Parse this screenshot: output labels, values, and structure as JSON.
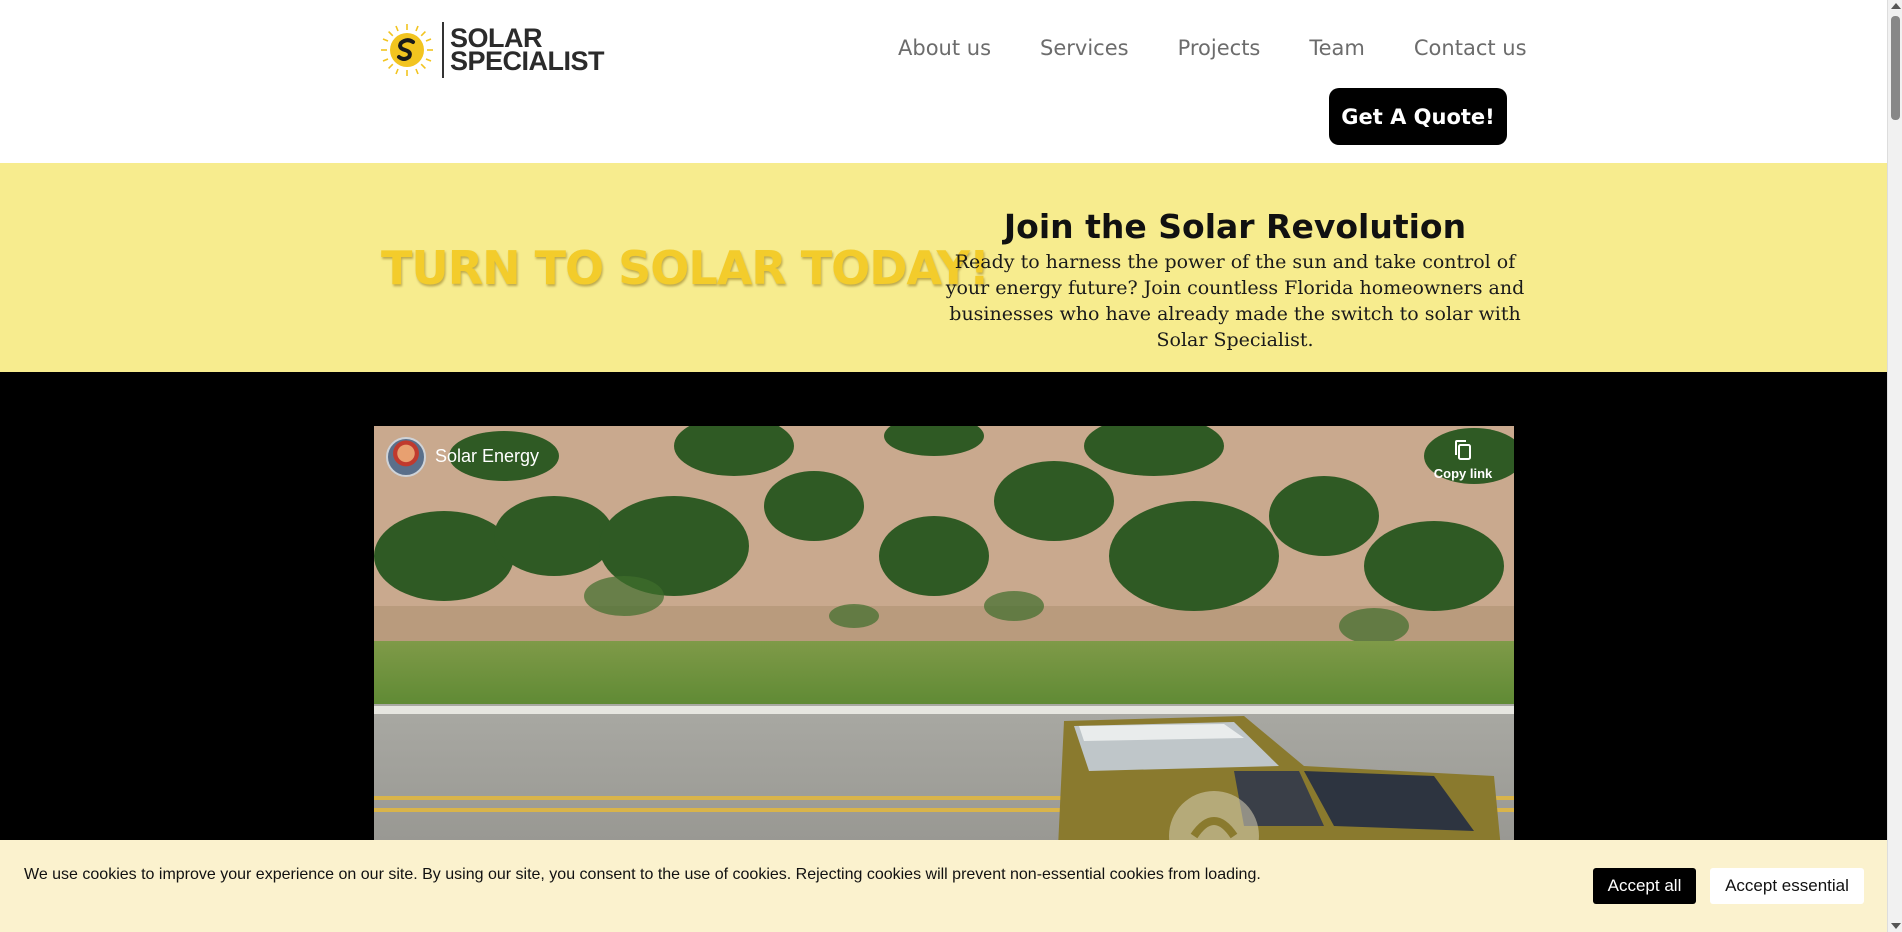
{
  "header": {
    "logo": {
      "line1": "SOLAR",
      "line2": "SPECIALIST"
    },
    "nav": [
      "About us",
      "Services",
      "Projects",
      "Team",
      "Contact us"
    ],
    "cta_label": "Get A Quote!"
  },
  "hero": {
    "tagline": "TURN TO SOLAR TODAY!",
    "title": "Join the Solar Revolution",
    "body": "Ready to harness the power of the sun and take control of your energy future? Join countless Florida homeowners and businesses who have already made the switch to solar with Solar Specialist."
  },
  "video": {
    "title": "Solar Energy",
    "copy_link_label": "Copy link"
  },
  "cookie_banner": {
    "text": "We use cookies to improve your experience on our site. By using our site, you consent to the use of cookies. Rejecting cookies will prevent non-essential cookies from loading.",
    "accept_all_label": "Accept all",
    "accept_essential_label": "Accept essential"
  },
  "colors": {
    "hero_background": "#f7ec8e",
    "tagline": "#f3cc2b",
    "brand_yellow": "#f2c41f",
    "cookie_background": "#fbf2ce"
  }
}
